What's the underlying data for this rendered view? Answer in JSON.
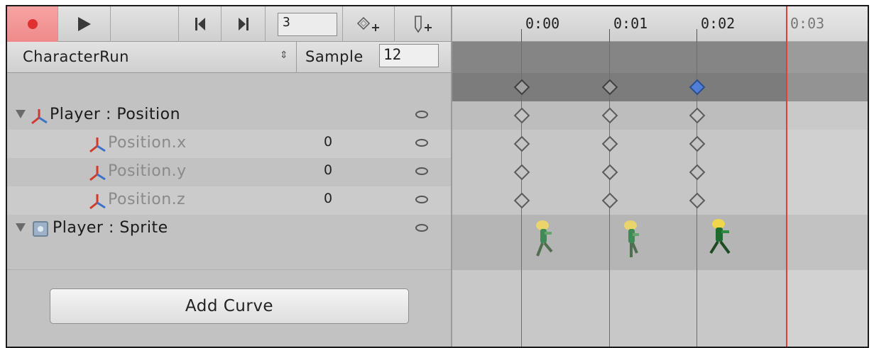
{
  "toolbar": {
    "frame_value": "3",
    "record_icon": "record-icon",
    "play_icon": "play-icon",
    "prev_icon": "prev-key-icon",
    "next_icon": "next-key-icon",
    "prev_glyph": "⏮",
    "next_glyph": "⏭",
    "add_keyframe_icon": "add-keyframe-icon",
    "add_event_icon": "add-event-icon"
  },
  "clip": {
    "name": "CharacterRun",
    "arrows": "⇕",
    "sample_label": "Sample",
    "sample_value": "12"
  },
  "properties": [
    {
      "label": "Player : Position",
      "value": "",
      "kind": "group"
    },
    {
      "label": "Position.x",
      "value": "0",
      "kind": "child"
    },
    {
      "label": "Position.y",
      "value": "0",
      "kind": "child"
    },
    {
      "label": "Position.z",
      "value": "0",
      "kind": "child"
    },
    {
      "label": "Player : Sprite",
      "value": "",
      "kind": "group"
    }
  ],
  "add_curve_label": "Add Curve",
  "timeline": {
    "ticks": [
      "0:00",
      "0:01",
      "0:02",
      "0:03"
    ],
    "keyframe_times": [
      0,
      1,
      2
    ],
    "selected_keyframe": 2,
    "playhead_time": 3
  },
  "colors": {
    "record_active": "#ef8a8a",
    "playhead": "#e0403a",
    "selected_key": "#4f7fd8"
  }
}
